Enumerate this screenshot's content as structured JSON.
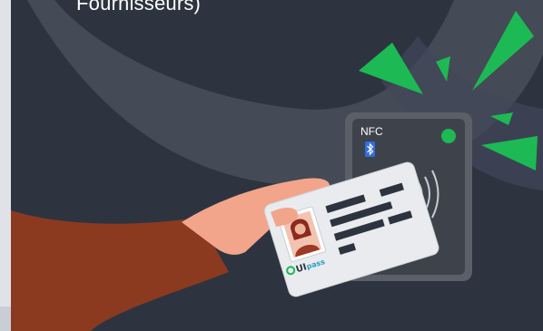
{
  "caption": "Fournisseurs)",
  "reader": {
    "label": "NFC",
    "icons": [
      "bluetooth-icon",
      "contactless-icon",
      "status-led"
    ]
  },
  "card": {
    "brand_prefix": "UI",
    "brand_suffix": "pass"
  },
  "colors": {
    "background": "#2d3440",
    "swoosh": "#4a4f5c",
    "accent_green": "#1db954",
    "reader_body": "#3e434b",
    "sleeve": "#8b3a1f",
    "skin": "#f2a58a",
    "card_teal": "#2a9ec0"
  }
}
